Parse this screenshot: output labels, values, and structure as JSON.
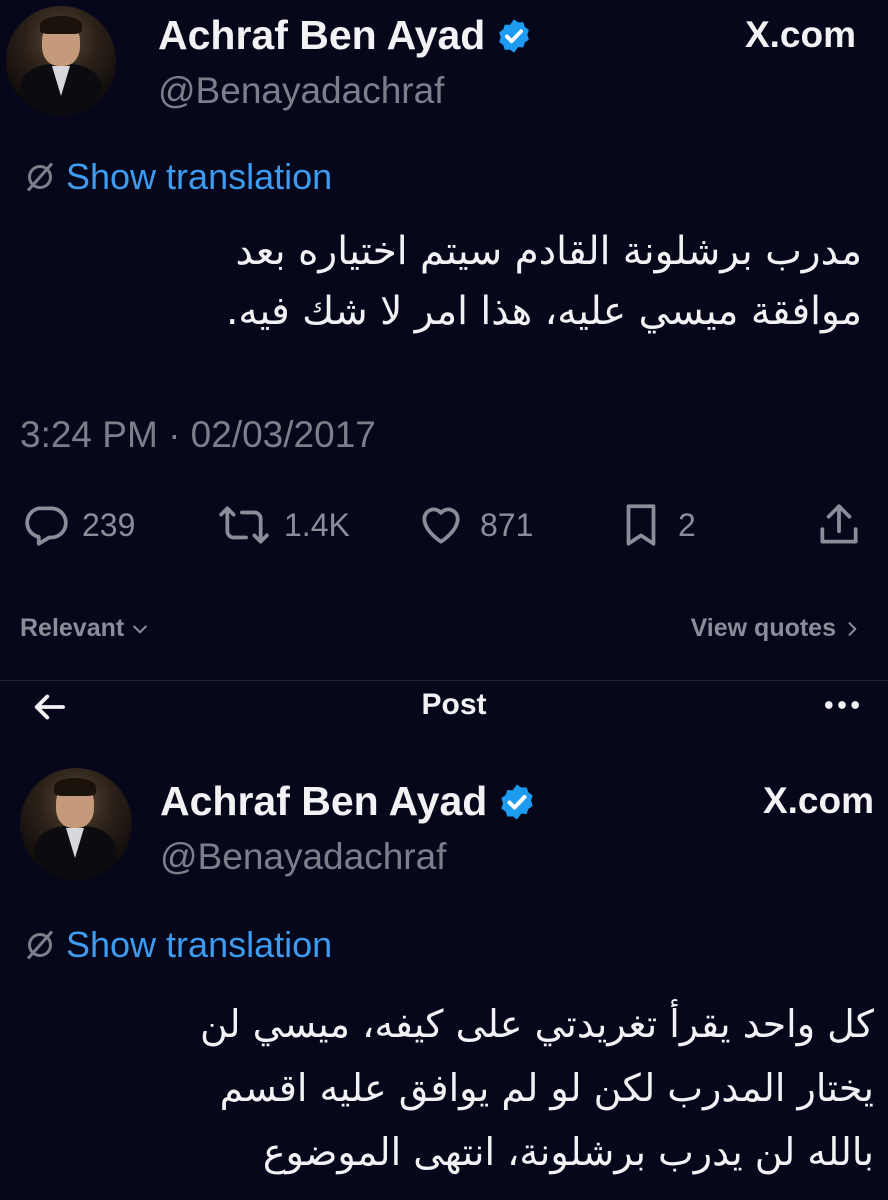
{
  "tweets": [
    {
      "name": "Achraf Ben Ayad",
      "handle": "@Benayadachraf",
      "site": "X.com",
      "translate_label": "Show translation",
      "text_line1": "مدرب برشلونة القادم سيتم اختياره بعد",
      "text_line2": "موافقة ميسي عليه، هذا امر لا شك فيه.",
      "timestamp": "3:24 PM · 02/03/2017",
      "stats": {
        "replies": "239",
        "reposts": "1.4K",
        "likes": "871",
        "bookmarks": "2"
      }
    },
    {
      "name": "Achraf Ben Ayad",
      "handle": "@Benayadachraf",
      "site": "X.com",
      "translate_label": "Show translation",
      "text_line1": "كل واحد يقرأ تغريدتي على كيفه، ميسي لن",
      "text_line2": "يختار المدرب لكن لو لم يوافق عليه اقسم",
      "text_line3": "بالله لن يدرب برشلونة، انتهى الموضوع"
    }
  ],
  "controls": {
    "relevant_label": "Relevant",
    "view_quotes_label": "View quotes"
  },
  "header": {
    "title": "Post"
  },
  "colors": {
    "background": "#07071c",
    "accent": "#3d9bf0",
    "verified": "#1d9bf0",
    "muted": "#7b7f8a"
  }
}
